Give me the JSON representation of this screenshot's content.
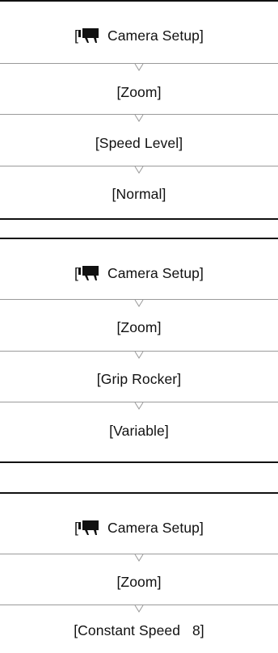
{
  "sequences": [
    {
      "steps": [
        {
          "label": "Camera Setup]",
          "prefix": "[",
          "icon": "movie-camera-icon"
        },
        {
          "label": "[Zoom]"
        },
        {
          "label": "[Speed Level]"
        },
        {
          "label": "[Normal]"
        }
      ]
    },
    {
      "steps": [
        {
          "label": "Camera Setup]",
          "prefix": "[",
          "icon": "movie-camera-icon"
        },
        {
          "label": "[Zoom]"
        },
        {
          "label": "[Grip Rocker]"
        },
        {
          "label": "[Variable]"
        }
      ]
    },
    {
      "steps": [
        {
          "label": "Camera Setup]",
          "prefix": "[",
          "icon": "movie-camera-icon"
        },
        {
          "label": "[Zoom]"
        },
        {
          "label": "[Constant Speed   8]"
        }
      ]
    }
  ],
  "colors": {
    "rule": "#111111",
    "separator": "#9a9a9a",
    "text": "#111111"
  }
}
